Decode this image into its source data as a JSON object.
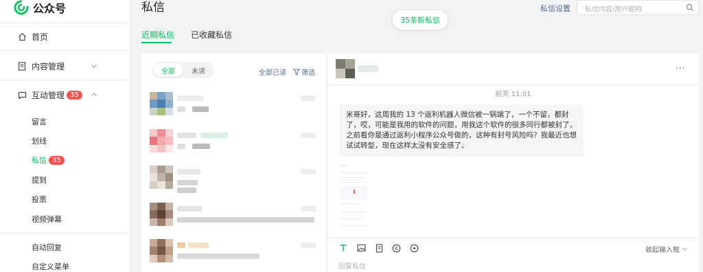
{
  "app": {
    "name": "公众号"
  },
  "sidebar": {
    "items": [
      {
        "label": "首页",
        "icon": "home-icon"
      },
      {
        "label": "内容管理",
        "icon": "document-icon"
      },
      {
        "label": "互动管理",
        "icon": "chat-icon",
        "badge": "35"
      }
    ],
    "sub_items": [
      {
        "label": "留言"
      },
      {
        "label": "划线"
      },
      {
        "label": "私信",
        "badge": "35",
        "active": true
      },
      {
        "label": "提到"
      },
      {
        "label": "投票"
      },
      {
        "label": "视频弹幕"
      }
    ],
    "bottom_items": [
      {
        "label": "自动回复"
      },
      {
        "label": "自定义菜单"
      }
    ]
  },
  "header": {
    "title": "私信",
    "settings_link": "私信设置",
    "search_placeholder": "私信内容/用户昵称",
    "new_messages": "35条新私信"
  },
  "tabs": [
    {
      "label": "近期私信",
      "active": true
    },
    {
      "label": "已收藏私信",
      "active": false
    }
  ],
  "list": {
    "segments": [
      {
        "label": "全部",
        "active": true
      },
      {
        "label": "未读",
        "active": false
      }
    ],
    "mark_all_read": "全部已读",
    "filter": "筛选"
  },
  "chat": {
    "timestamp": "前天 11:01",
    "message": "米哥好，这周我的 13 个返利机器人微信被一锅端了，一个不留，都封了，哎，可能是我用的软件的问题，用我这个软件的很多同行都被封了，之前看你是通过返利小程序公众号做的，这种有封号风险吗？我最近也想试试转型，现在这样太没有安全感了。",
    "collapse_label": "收起输入框",
    "reply_placeholder": "回复私信",
    "toolbar_icons": [
      "text-icon",
      "image-icon",
      "document-icon",
      "audio-icon",
      "video-icon"
    ]
  },
  "colors": {
    "accent": "#07c160",
    "link": "#576b95",
    "badge": "#fa5151"
  }
}
